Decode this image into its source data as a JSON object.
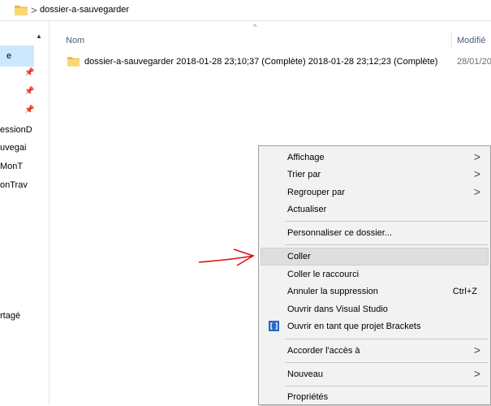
{
  "breadcrumb": {
    "current": "dossier-a-sauvegarder",
    "separator": ">"
  },
  "nav": {
    "items": [
      {
        "label": "e",
        "pinned": false,
        "selected": true
      },
      {
        "label": "",
        "pinned": true
      },
      {
        "label": "",
        "pinned": true
      },
      {
        "label": "",
        "pinned": true
      },
      {
        "label": "essionD",
        "pinned": false
      },
      {
        "label": "uvegai",
        "pinned": false
      },
      {
        "label": "MonT",
        "pinned": false
      },
      {
        "label": "onTrav",
        "pinned": false
      },
      {
        "label": "rtagé",
        "pinned": false
      }
    ]
  },
  "columns": {
    "name": "Nom",
    "modified": "Modifié"
  },
  "files": [
    {
      "name": "dossier-a-sauvegarder 2018-01-28 23;10;37 (Complète) 2018-01-28 23;12;23 (Complète)",
      "modified": "28/01/20"
    }
  ],
  "context_menu": {
    "items": [
      {
        "label": "Affichage",
        "submenu": true
      },
      {
        "label": "Trier par",
        "submenu": true
      },
      {
        "label": "Regrouper par",
        "submenu": true
      },
      {
        "label": "Actualiser"
      },
      {
        "label": "Personnaliser ce dossier..."
      },
      {
        "label": "Coller",
        "highlighted": true
      },
      {
        "label": "Coller le raccourci"
      },
      {
        "label": "Annuler la suppression",
        "shortcut": "Ctrl+Z"
      },
      {
        "label": "Ouvrir dans Visual Studio"
      },
      {
        "label": "Ouvrir en tant que projet Brackets",
        "icon": "brackets-icon"
      },
      {
        "label": "Accorder l'accès à",
        "submenu": true
      },
      {
        "label": "Nouveau",
        "submenu": true
      },
      {
        "label": "Propriétés"
      }
    ],
    "submenu_glyph": ">"
  },
  "colors": {
    "folder": "#f8d775",
    "folder_dark": "#e0b53c",
    "menu_bg": "#f2f2f2",
    "menu_highlight": "#dedede",
    "nav_selected": "#cce8ff",
    "column_header": "#4c607a",
    "arrow": "#e01010"
  }
}
